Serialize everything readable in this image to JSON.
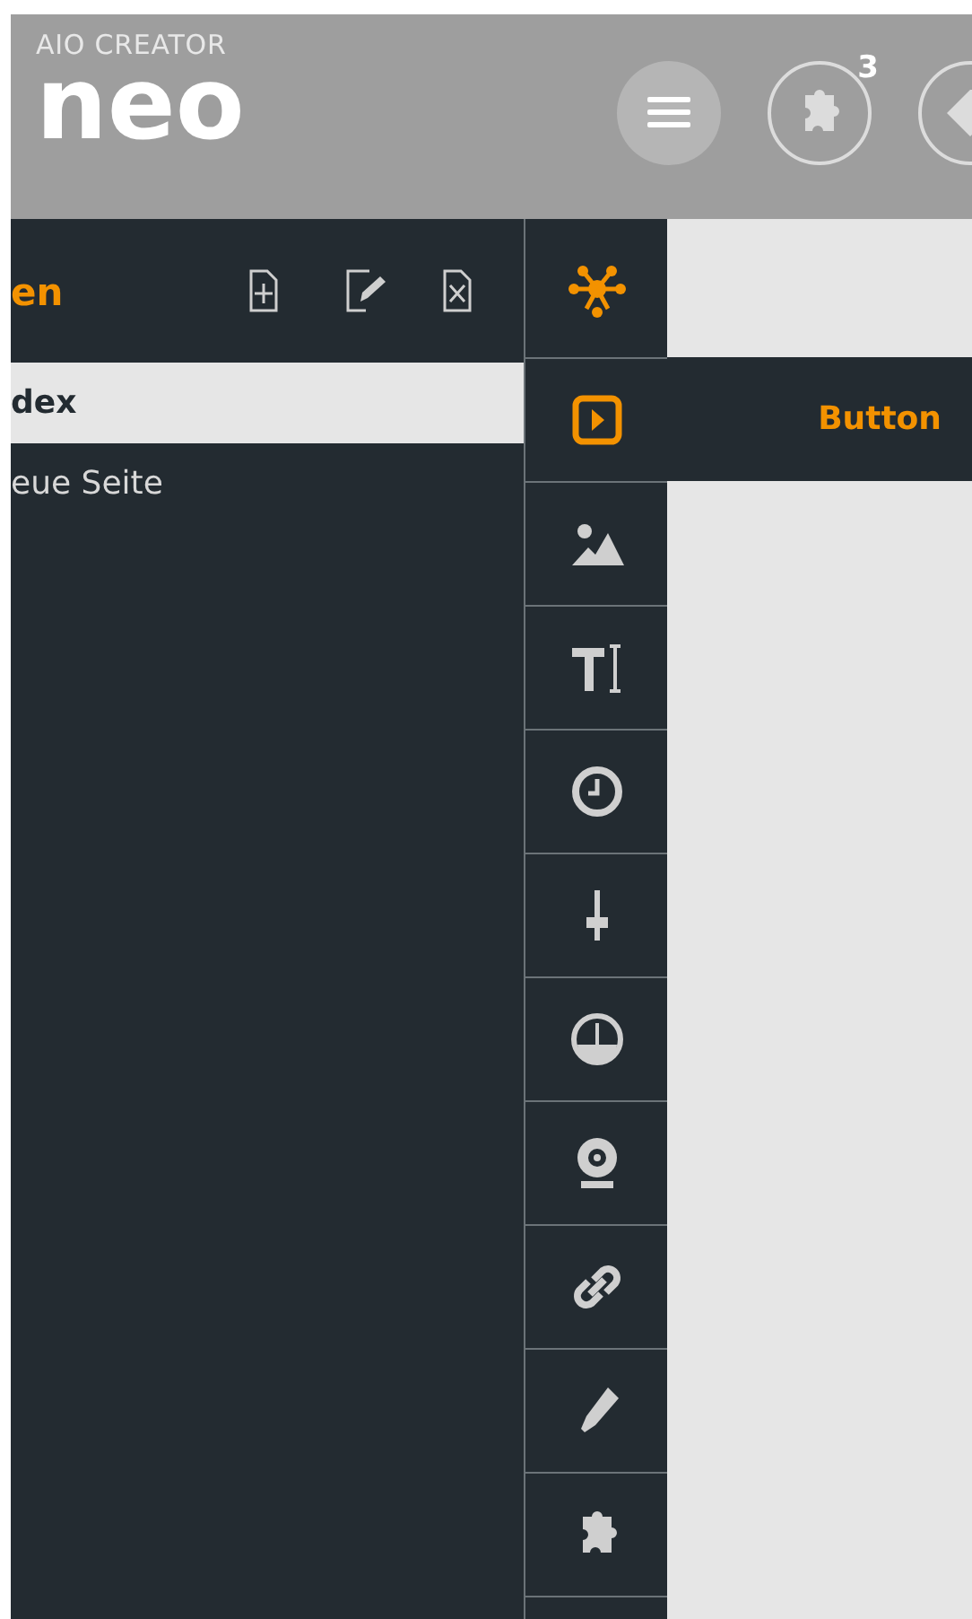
{
  "header": {
    "logo_caption": "AIO CREATOR",
    "logo_word": "neo",
    "buttons": [
      {
        "kind": "menu"
      },
      {
        "kind": "plugins",
        "badge": "3"
      },
      {
        "kind": "tag"
      }
    ]
  },
  "pages_panel": {
    "title": "en",
    "actions": [
      {
        "kind": "add"
      },
      {
        "kind": "edit"
      },
      {
        "kind": "delete"
      }
    ],
    "pages": [
      {
        "label": "dex",
        "selected": true
      },
      {
        "label": "eue Seite",
        "selected": false
      }
    ]
  },
  "tools": [
    {
      "kind": "network",
      "selected": false
    },
    {
      "kind": "button",
      "selected": true,
      "label": "Button"
    },
    {
      "kind": "image",
      "selected": false
    },
    {
      "kind": "text",
      "selected": false
    },
    {
      "kind": "clock",
      "selected": false
    },
    {
      "kind": "slider",
      "selected": false
    },
    {
      "kind": "gauge",
      "selected": false
    },
    {
      "kind": "webcam",
      "selected": false
    },
    {
      "kind": "link",
      "selected": false
    },
    {
      "kind": "pen",
      "selected": false
    },
    {
      "kind": "plugin",
      "selected": false
    }
  ]
}
